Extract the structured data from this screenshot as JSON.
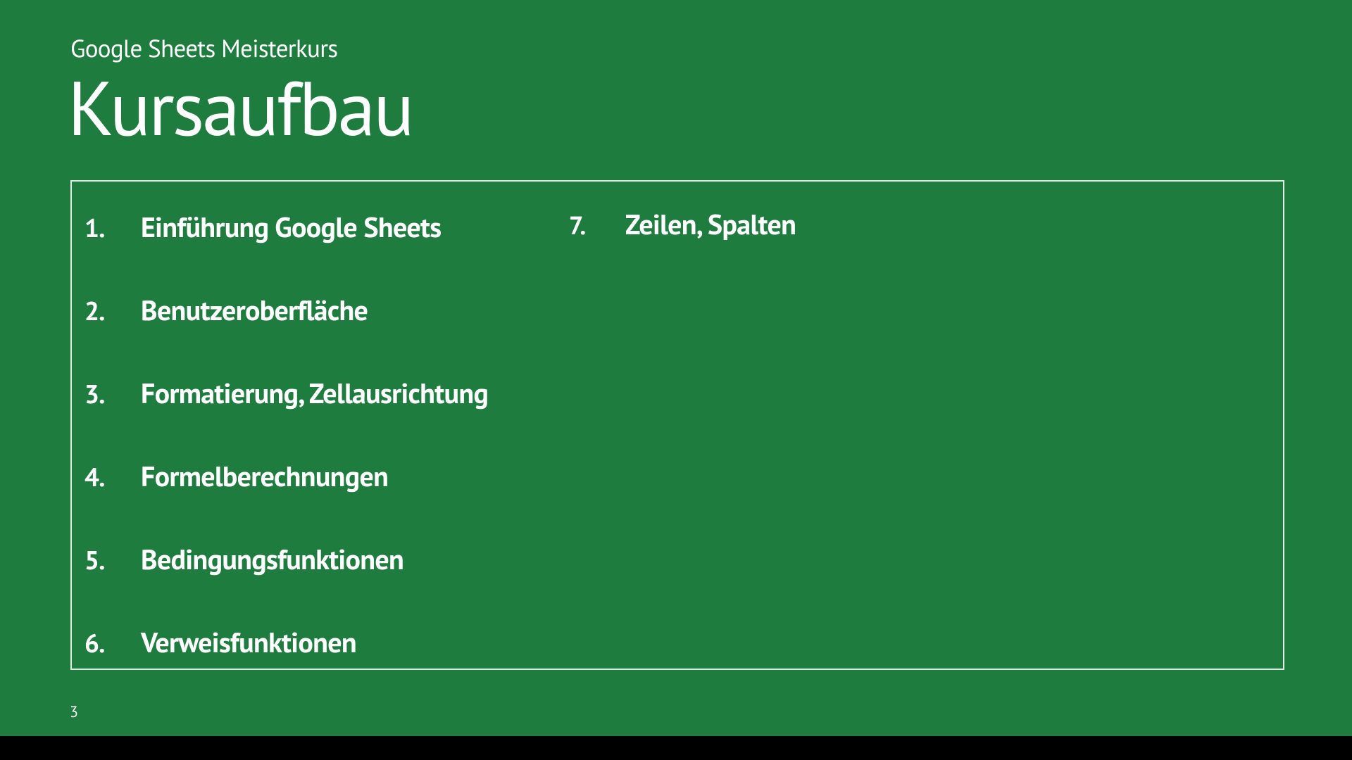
{
  "subtitle": "Google Sheets Meisterkurs",
  "title": "Kursaufbau",
  "items": [
    {
      "num": "1.",
      "label": "Einführung Google Sheets"
    },
    {
      "num": "2.",
      "label": "Benutzeroberfläche"
    },
    {
      "num": "3.",
      "label": "Formatierung, Zellausrichtung"
    },
    {
      "num": "4.",
      "label": "Formelberechnungen"
    },
    {
      "num": "5.",
      "label": "Bedingungsfunktionen"
    },
    {
      "num": "6.",
      "label": "Verweisfunktionen"
    },
    {
      "num": "7.",
      "label": "Zeilen, Spalten"
    }
  ],
  "page_number": "3"
}
